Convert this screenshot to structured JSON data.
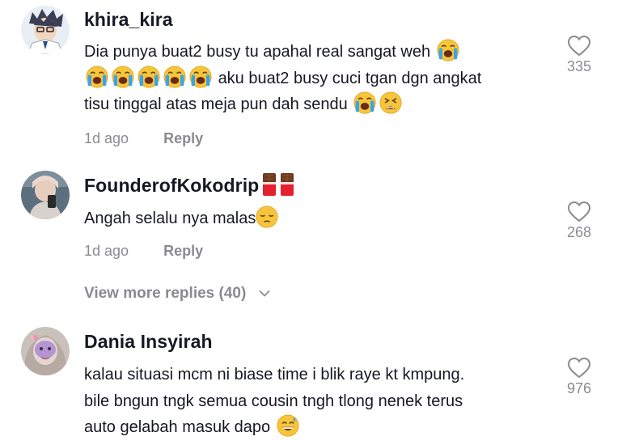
{
  "comments": [
    {
      "username": "khira_kira",
      "lines": [
        "Dia punya buat2 busy tu apahal real sangat weh",
        "aku buat2 busy cuci tgan dgn angkat",
        "tisu tinggal atas meja pun dah sendu"
      ],
      "time": "1d ago",
      "reply_label": "Reply",
      "likes": "335",
      "emojis": [
        "loudly-crying-face",
        "loudly-crying-face",
        "loudly-crying-face",
        "loudly-crying-face",
        "loudly-crying-face",
        "loudly-crying-face",
        "loudly-crying-face",
        "tired-face"
      ]
    },
    {
      "username": "FounderofKokodrip",
      "username_emojis": [
        "chocolate-bar",
        "chocolate-bar"
      ],
      "lines": [
        "Angah selalu nya malas"
      ],
      "time": "1d ago",
      "reply_label": "Reply",
      "likes": "268",
      "emojis": [
        "pensive-face"
      ]
    },
    {
      "username": "Dania Insyirah",
      "lines": [
        "kalau situasi mcm ni biase time i blik raye kt kmpung.",
        "bile bngun tngk semua cousin tngh tlong nenek terus",
        "auto gelabah masuk dapo"
      ],
      "likes": "976",
      "emojis": [
        "grinning-face-with-sweat"
      ]
    }
  ],
  "view_more_replies": "View more replies (40)",
  "colors": {
    "text": "#161823",
    "muted": "#8a8b91",
    "emoji_yellow": "#f7c53b",
    "tear_blue": "#3aa3e8",
    "chocolate": "#6b3a1e",
    "wrapper_red": "#e3212f"
  }
}
